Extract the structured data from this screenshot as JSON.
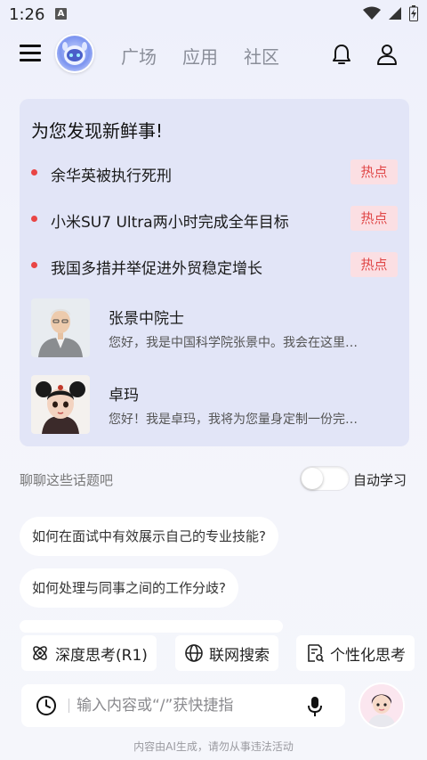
{
  "status_bar": {
    "time": "1:26",
    "notification_letter": "A"
  },
  "header": {
    "tabs": [
      {
        "label": "广场"
      },
      {
        "label": "应用"
      },
      {
        "label": "社区"
      }
    ]
  },
  "discovery": {
    "title": "为您发现新鲜事!",
    "news": [
      {
        "text": "余华英被执行死刑",
        "badge": "热点"
      },
      {
        "text": "小米SU7 Ultra两小时完成全年目标",
        "badge": "热点"
      },
      {
        "text": "我国多措并举促进外贸稳定增长",
        "badge": "热点"
      }
    ],
    "personas": [
      {
        "name": "张景中院士",
        "desc": "您好，我是中国科学院张景中。我会在这里…"
      },
      {
        "name": "卓玛",
        "desc": "您好！我是卓玛，我将为您量身定制一份完…"
      }
    ]
  },
  "topics": {
    "label": "聊聊这些话题吧",
    "auto_learn_label": "自动学习",
    "auto_learn_on": false,
    "suggestions": [
      {
        "text": "如何在面试中有效展示自己的专业技能?"
      },
      {
        "text": "如何处理与同事之间的工作分歧?"
      }
    ]
  },
  "actions": {
    "chips": [
      {
        "label": "深度思考(R1)",
        "icon": "atom-icon"
      },
      {
        "label": "联网搜索",
        "icon": "globe-icon"
      },
      {
        "label": "个性化思考",
        "icon": "document-search-icon"
      }
    ]
  },
  "input": {
    "placeholder": "输入内容或“/”获快捷指"
  },
  "footer": {
    "disclaimer": "内容由AI生成，请勿从事违法活动"
  },
  "colors": {
    "hot_badge_bg": "#fbdfe3",
    "hot_badge_text": "#e04848",
    "card_bg": "#e2e5f7",
    "dot": "#e94545"
  }
}
